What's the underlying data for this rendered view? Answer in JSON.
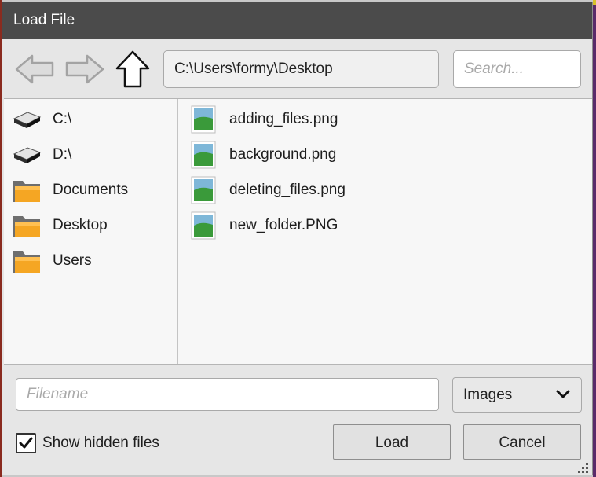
{
  "window": {
    "title": "Load File"
  },
  "toolbar": {
    "back_icon": "arrow-left-icon",
    "forward_icon": "arrow-right-icon",
    "up_icon": "arrow-up-icon",
    "path_value": "C:\\Users\\formy\\Desktop",
    "search_placeholder": "Search..."
  },
  "locations": [
    {
      "label": "C:\\",
      "icon": "drive-icon"
    },
    {
      "label": "D:\\",
      "icon": "drive-icon"
    },
    {
      "label": "Documents",
      "icon": "folder-icon"
    },
    {
      "label": "Desktop",
      "icon": "folder-icon"
    },
    {
      "label": "Users",
      "icon": "folder-icon"
    }
  ],
  "files": [
    {
      "label": "adding_files.png",
      "icon": "image-file-icon"
    },
    {
      "label": "background.png",
      "icon": "image-file-icon"
    },
    {
      "label": "deleting_files.png",
      "icon": "image-file-icon"
    },
    {
      "label": "new_folder.PNG",
      "icon": "image-file-icon"
    }
  ],
  "footer": {
    "filename_placeholder": "Filename",
    "filetype_selected": "Images",
    "show_hidden_label": "Show hidden files",
    "show_hidden_checked": true,
    "load_label": "Load",
    "cancel_label": "Cancel"
  },
  "colors": {
    "titlebar_bg": "#4b4b4b",
    "folder": "#f5a623",
    "image_green": "#3a9a3a",
    "image_sky": "#7eb7d8"
  }
}
